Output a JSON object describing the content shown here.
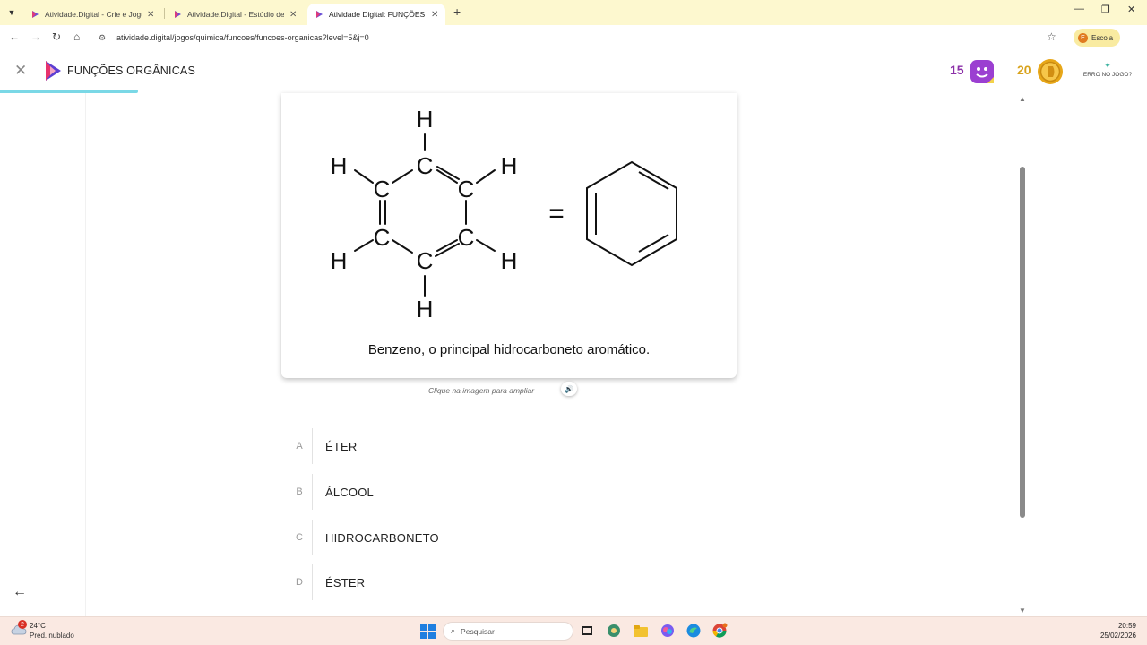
{
  "browser": {
    "tabs": [
      {
        "label": "Atividade.Digital - Crie e Jogue"
      },
      {
        "label": "Atividade.Digital - Estúdio de A"
      },
      {
        "label": "Atividade Digital: FUNÇÕES OR"
      }
    ],
    "url": "atividade.digital/jogos/quimica/funcoes/funcoes-organicas?level=5&j=0",
    "profile_label": "Escola",
    "profile_initial": "E"
  },
  "app": {
    "title": "FUNÇÕES ORGÂNICAS",
    "progress_fraction": 0.12,
    "score_purple": "15",
    "score_gold": "20",
    "report_label": "ERRO NO JOGO?",
    "accent_color": "#7ad8e6"
  },
  "question": {
    "image_caption": "Benzeno, o principal hidrocarboneto aromático.",
    "structure": {
      "atom_c": "C",
      "atom_h": "H",
      "equals": "="
    },
    "hint": "Clique na imagem para ampliar",
    "options": [
      {
        "letter": "A",
        "text": "ÉTER"
      },
      {
        "letter": "B",
        "text": "ÁLCOOL"
      },
      {
        "letter": "C",
        "text": "HIDROCARBONETO"
      },
      {
        "letter": "D",
        "text": "ÉSTER"
      }
    ]
  },
  "taskbar": {
    "temperature": "24°C",
    "weather": "Pred. nublado",
    "weather_badge": "2",
    "search_placeholder": "Pesquisar",
    "time": "20:59",
    "date": "25/02/2026"
  }
}
